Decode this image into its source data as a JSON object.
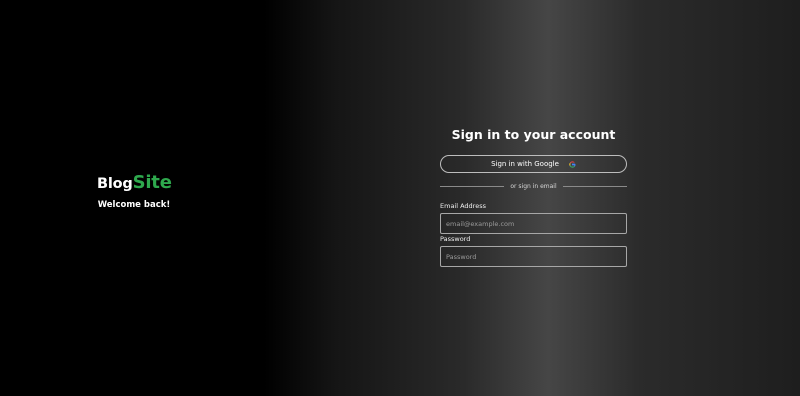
{
  "brand": {
    "logo_part1": "Blog",
    "logo_part2": "Site",
    "tagline": "Welcome back!"
  },
  "signin": {
    "title": "Sign in to your account",
    "google_button": "Sign in with Google",
    "google_icon": "google-icon",
    "divider_text": "or sign in email",
    "email_label": "Email Address",
    "email_placeholder": "email@example.com",
    "password_label": "Password",
    "password_placeholder": "Password"
  },
  "colors": {
    "accent": "#2ea84d",
    "text": "#ffffff"
  }
}
